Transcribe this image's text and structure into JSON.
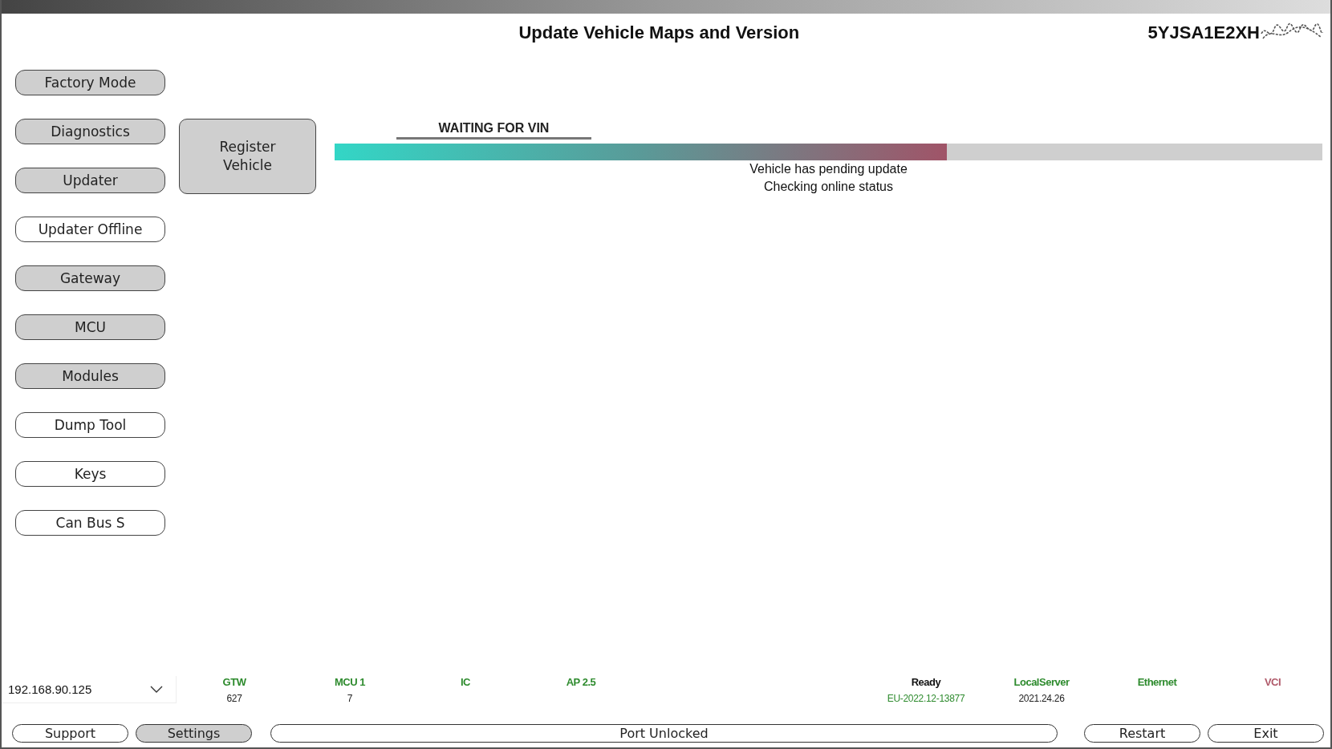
{
  "header": {
    "title": "Update Vehicle Maps and Version",
    "vin": "5YJSA1E2XH"
  },
  "sidebar": {
    "items": [
      {
        "label": "Factory Mode",
        "filled": true
      },
      {
        "label": "Diagnostics",
        "filled": true
      },
      {
        "label": "Updater",
        "filled": true
      },
      {
        "label": "Updater Offline",
        "filled": false
      },
      {
        "label": "Gateway",
        "filled": true
      },
      {
        "label": "MCU",
        "filled": true
      },
      {
        "label": "Modules",
        "filled": true
      },
      {
        "label": "Dump Tool",
        "filled": false
      },
      {
        "label": "Keys",
        "filled": false
      },
      {
        "label": "Can Bus S",
        "filled": false
      }
    ]
  },
  "register_button": {
    "label": "Register\nVehicle"
  },
  "progress": {
    "stage": "WAITING FOR VIN",
    "level": 0.62,
    "messages": [
      "Vehicle has pending update",
      "Checking online status"
    ]
  },
  "status_bar": {
    "ip_select": {
      "value": "192.168.90.125"
    },
    "modules": [
      {
        "label": "GTW",
        "color": "#2e8b2e",
        "value": "627",
        "value_highlighted": false
      },
      {
        "label": "MCU 1",
        "color": "#2e8b2e",
        "value": "7",
        "value_highlighted": false
      },
      {
        "label": "IC",
        "color": "#2e8b2e"
      },
      {
        "label": "AP 2.5",
        "color": "#2e8b2e"
      }
    ],
    "connections": [
      {
        "label": "Ready",
        "color": "#111111",
        "value": "EU-2022.12-13877",
        "value_highlighted": true
      },
      {
        "label": "LocalServer",
        "color": "#2e8b2e",
        "value": "2021.24.26",
        "value_highlighted": false
      },
      {
        "label": "Ethernet",
        "color": "#2e8b2e"
      },
      {
        "label": "VCI",
        "color": "#b05a6a"
      }
    ]
  },
  "footer_buttons": [
    {
      "label": "Support",
      "filled": false,
      "kind": "small"
    },
    {
      "label": "Settings",
      "filled": true,
      "kind": "small"
    },
    {
      "label": "Port Unlocked",
      "filled": false,
      "kind": "wide"
    },
    {
      "label": "Restart",
      "filled": false,
      "kind": "small"
    },
    {
      "label": "Exit",
      "filled": false,
      "kind": "small"
    }
  ]
}
